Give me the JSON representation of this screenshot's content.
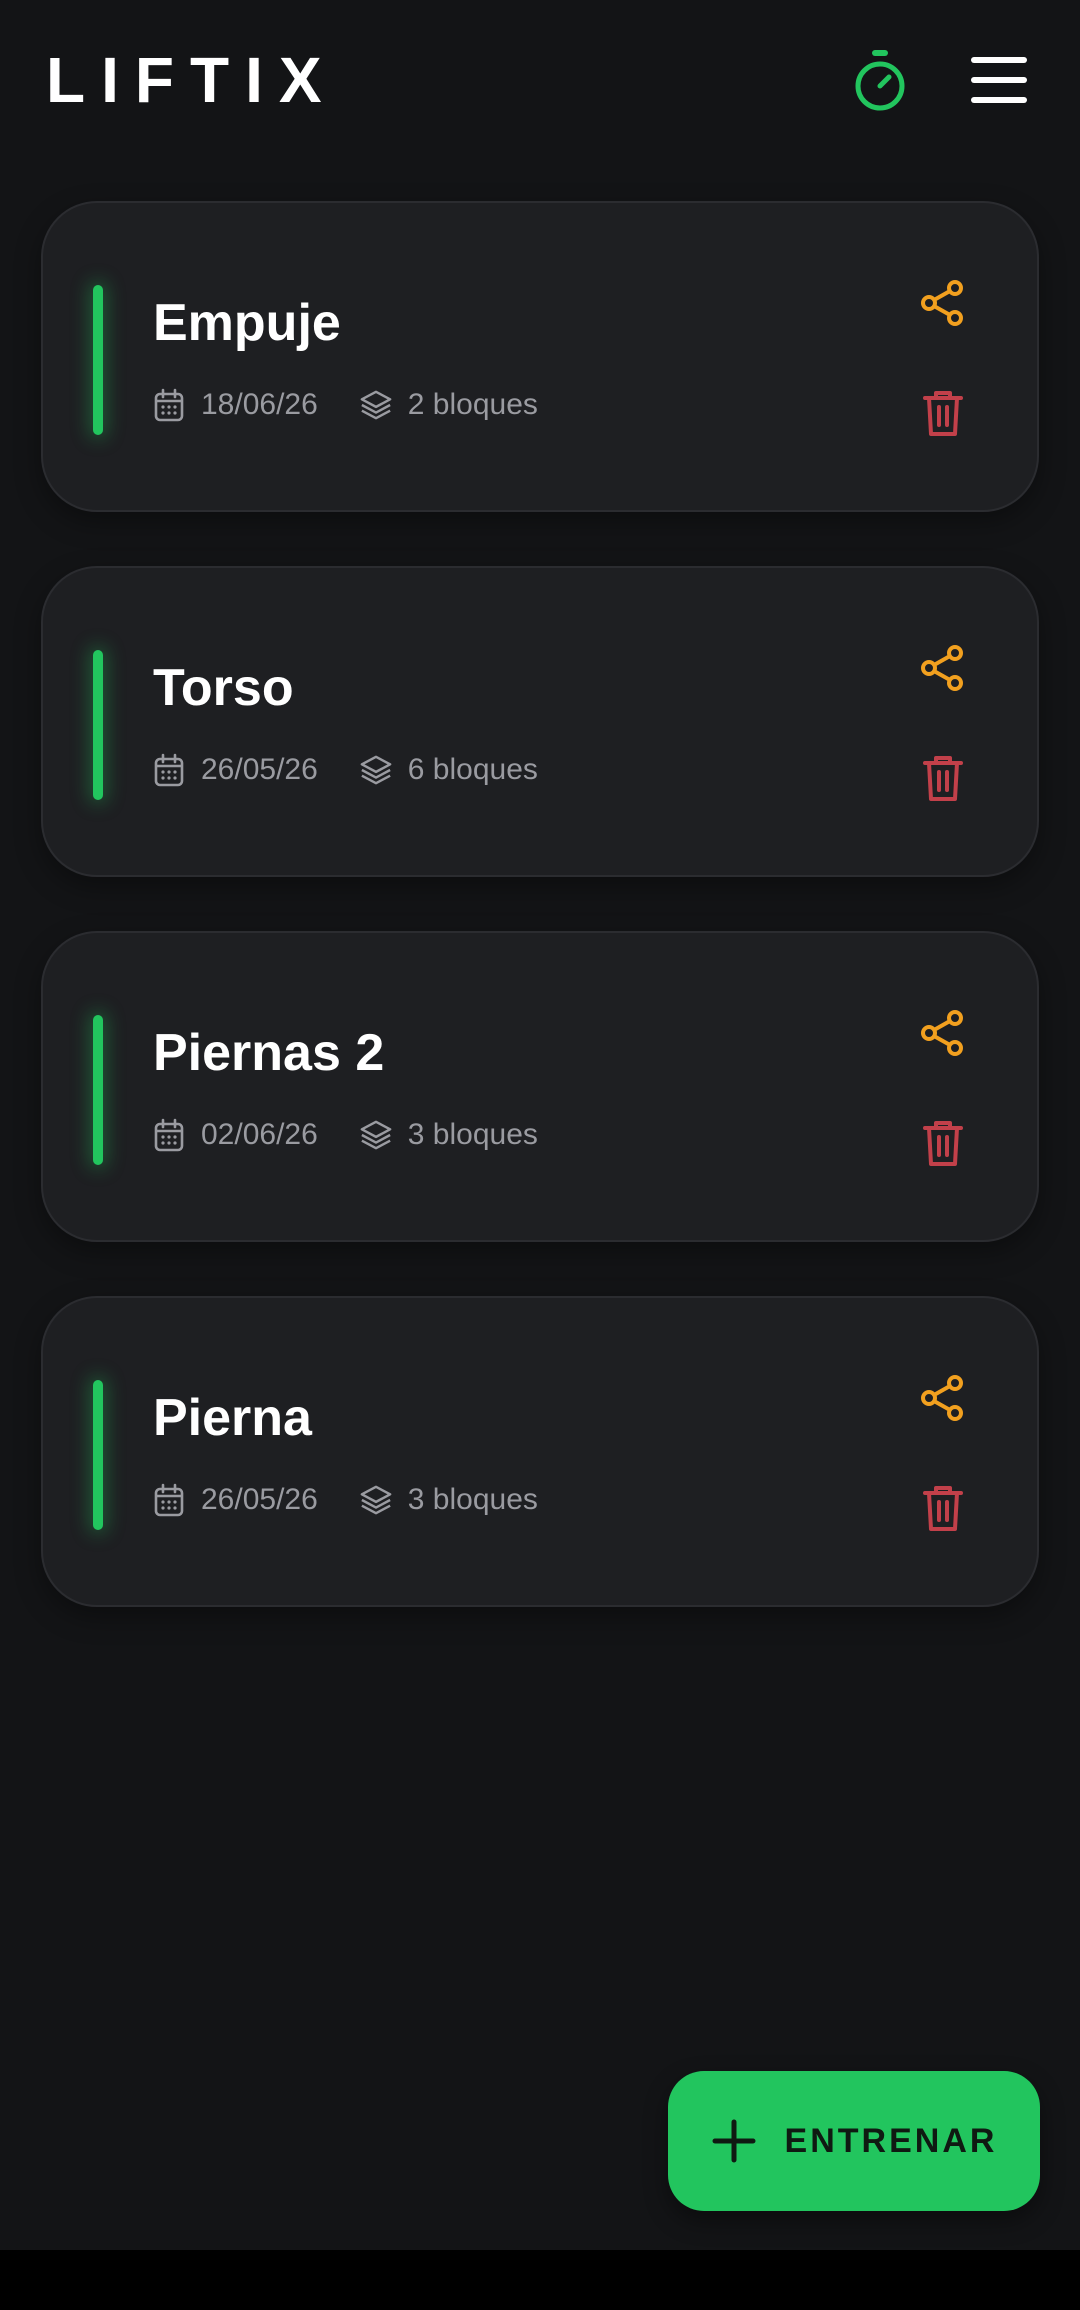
{
  "app": {
    "name": "LIFTIX"
  },
  "header": {
    "timer_icon": "stopwatch-icon",
    "menu_icon": "hamburger-menu-icon"
  },
  "colors": {
    "background": "#131416",
    "card": "#1e1f22",
    "accent": "#22c55e",
    "share": "#f2a01f",
    "delete": "#c2404a",
    "meta_text": "#9a9ba1"
  },
  "workouts": [
    {
      "title": "Empuje",
      "date": "18/06/26",
      "blocks": "2 bloques"
    },
    {
      "title": "Torso",
      "date": "26/05/26",
      "blocks": "6 bloques"
    },
    {
      "title": "Piernas 2",
      "date": "02/06/26",
      "blocks": "3 bloques"
    },
    {
      "title": "Pierna",
      "date": "26/05/26",
      "blocks": "3 bloques"
    }
  ],
  "card_icons": {
    "date": "calendar-icon",
    "blocks": "layers-icon",
    "share": "share-icon",
    "delete": "trash-icon"
  },
  "fab": {
    "label": "ENTRENAR",
    "icon": "plus-icon"
  }
}
